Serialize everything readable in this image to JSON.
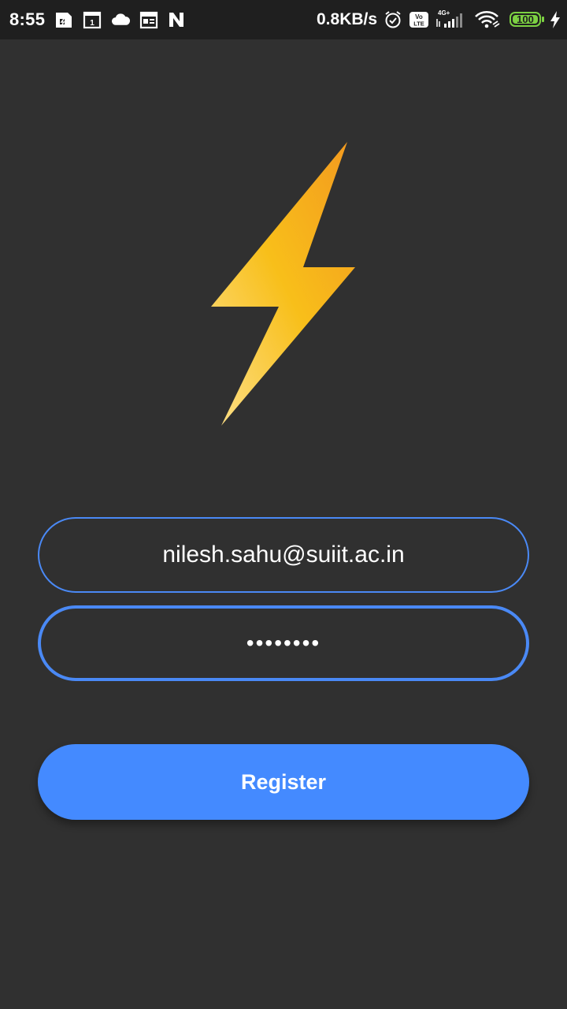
{
  "status_bar": {
    "time": "8:55",
    "network_speed": "0.8KB/s",
    "network_type": "4G+",
    "volte_label": "Vo LTE",
    "battery_level": "100",
    "icons": [
      "sim-card-icon",
      "calendar-icon",
      "cloud-icon",
      "newspaper-icon",
      "n-icon",
      "alarm-icon",
      "volte-icon",
      "signal-icon",
      "wifi-icon",
      "battery-icon",
      "charging-icon"
    ]
  },
  "logo": {
    "icon": "lightning-bolt-icon",
    "gradient_start": "#fbd56b",
    "gradient_mid": "#f8bf1a",
    "gradient_end": "#f4a023"
  },
  "form": {
    "email_value": "nilesh.sahu@suiit.ac.in",
    "password_value": "••••••••",
    "register_label": "Register"
  },
  "colors": {
    "background": "#303030",
    "status_bar": "#1f1f1f",
    "accent": "#448aff",
    "field_border": "#4a89f5",
    "battery": "#7cd142"
  }
}
